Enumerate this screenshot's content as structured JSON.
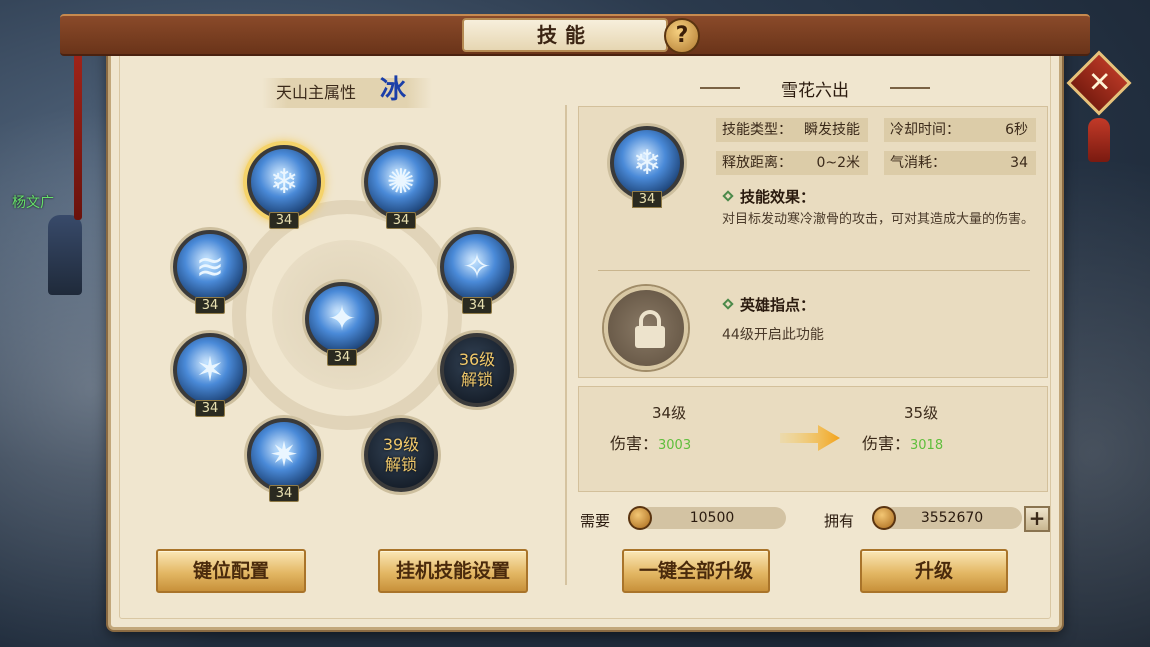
{
  "background": {
    "npc_name": "杨文广"
  },
  "title": "技能",
  "help_label": "?",
  "close_label": "✕",
  "attribute": {
    "label": "天山主属性",
    "element": "冰"
  },
  "skills": [
    {
      "name": "skill-snowflake",
      "glyph": "❄",
      "level": "34"
    },
    {
      "name": "skill-vortex",
      "glyph": "✺",
      "level": "34"
    },
    {
      "name": "skill-wave",
      "glyph": "≋",
      "level": "34"
    },
    {
      "name": "skill-slash",
      "glyph": "✧",
      "level": "34"
    },
    {
      "name": "skill-burst",
      "glyph": "✦",
      "level": "34"
    },
    {
      "name": "skill-shatter",
      "glyph": "✶",
      "level": "34"
    },
    {
      "name": "skill-storm",
      "glyph": "✷",
      "level": "34"
    }
  ],
  "locked_skills": [
    {
      "line1": "36级",
      "line2": "解锁"
    },
    {
      "line1": "39级",
      "line2": "解锁"
    }
  ],
  "buttons": {
    "keybind": "键位配置",
    "auto_skill": "挂机技能设置",
    "upgrade_all": "一键全部升级",
    "upgrade": "升级"
  },
  "detail": {
    "skill_name": "雪花六出",
    "skill_level": "34",
    "skill_glyph": "❄",
    "type_label": "技能类型：",
    "type_value": "瞬发技能",
    "cooldown_label": "冷却时间：",
    "cooldown_value": "6秒",
    "range_label": "释放距离：",
    "range_value": "0~2米",
    "qi_label": "气消耗：",
    "qi_value": "34",
    "effect_title": "技能效果：",
    "effect_desc": "对目标发动寒冷澈骨的攻击，可对其造成大量的伤害。",
    "hero_title": "英雄指点：",
    "hero_desc": "44级开启此功能"
  },
  "upgrade": {
    "current_level": "34级",
    "next_level": "35级",
    "damage_label": "伤害：",
    "current_damage": "3003",
    "next_damage": "3018"
  },
  "cost": {
    "need_label": "需要",
    "need_value": "10500",
    "own_label": "拥有",
    "own_value": "3552670",
    "plus_label": "+"
  }
}
